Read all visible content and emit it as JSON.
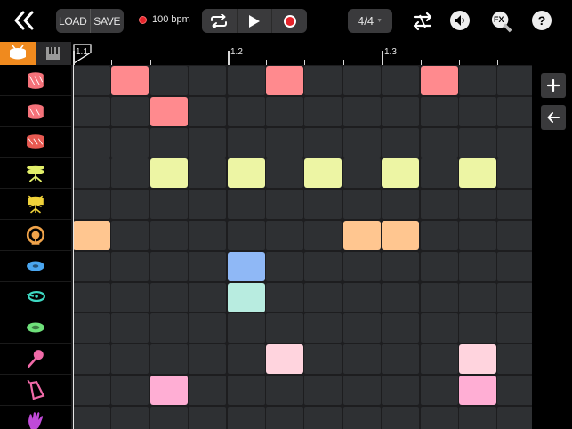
{
  "toolbar": {
    "load_label": "LOAD",
    "save_label": "SAVE",
    "tempo": "100 bpm",
    "time_signature": "4/4",
    "fx_label": "FX",
    "help_label": "?"
  },
  "ruler": {
    "markers": [
      "1.1",
      "1.2",
      "1.3"
    ]
  },
  "colors": {
    "accent": "#f08a1e",
    "cell": "#2e3033",
    "record": "#e5242b"
  },
  "instruments": [
    {
      "name": "snare-drum-red",
      "color": "#f5727a"
    },
    {
      "name": "snare-drum-pink",
      "color": "#f5727a"
    },
    {
      "name": "tom-drum",
      "color": "#e85a52"
    },
    {
      "name": "hihat-cymbal",
      "color": "#e2ef6a"
    },
    {
      "name": "snare-stand",
      "color": "#f0d23a"
    },
    {
      "name": "kick-drum",
      "color": "#f0a34a"
    },
    {
      "name": "ride-cymbal",
      "color": "#4aa6f0"
    },
    {
      "name": "crash-cymbal",
      "color": "#3ed8c2"
    },
    {
      "name": "splash-cymbal",
      "color": "#6ee07a"
    },
    {
      "name": "maraca",
      "color": "#f06aa8"
    },
    {
      "name": "cowbell",
      "color": "#f06aa8"
    },
    {
      "name": "clap-hand",
      "color": "#c04ad8"
    }
  ],
  "notes": [
    {
      "row": 0,
      "step": 1,
      "color": "#ff8a8e"
    },
    {
      "row": 0,
      "step": 5,
      "color": "#ff8a8e"
    },
    {
      "row": 0,
      "step": 9,
      "color": "#ff8a8e"
    },
    {
      "row": 1,
      "step": 2,
      "color": "#ff8a8e"
    },
    {
      "row": 3,
      "step": 2,
      "color": "#edf5a4"
    },
    {
      "row": 3,
      "step": 4,
      "color": "#edf5a4"
    },
    {
      "row": 3,
      "step": 6,
      "color": "#edf5a4"
    },
    {
      "row": 3,
      "step": 8,
      "color": "#edf5a4"
    },
    {
      "row": 3,
      "step": 10,
      "color": "#edf5a4"
    },
    {
      "row": 5,
      "step": 0,
      "color": "#ffc690"
    },
    {
      "row": 5,
      "step": 7,
      "color": "#ffc690"
    },
    {
      "row": 5,
      "step": 8,
      "color": "#ffc690"
    },
    {
      "row": 6,
      "step": 4,
      "color": "#8fb8f6"
    },
    {
      "row": 7,
      "step": 4,
      "color": "#b8ece0"
    },
    {
      "row": 9,
      "step": 5,
      "color": "#ffd4de"
    },
    {
      "row": 9,
      "step": 10,
      "color": "#ffd4de"
    },
    {
      "row": 10,
      "step": 2,
      "color": "#ffaed4"
    },
    {
      "row": 10,
      "step": 10,
      "color": "#ffaed4"
    }
  ],
  "grid": {
    "rows": 12,
    "steps": 12
  }
}
